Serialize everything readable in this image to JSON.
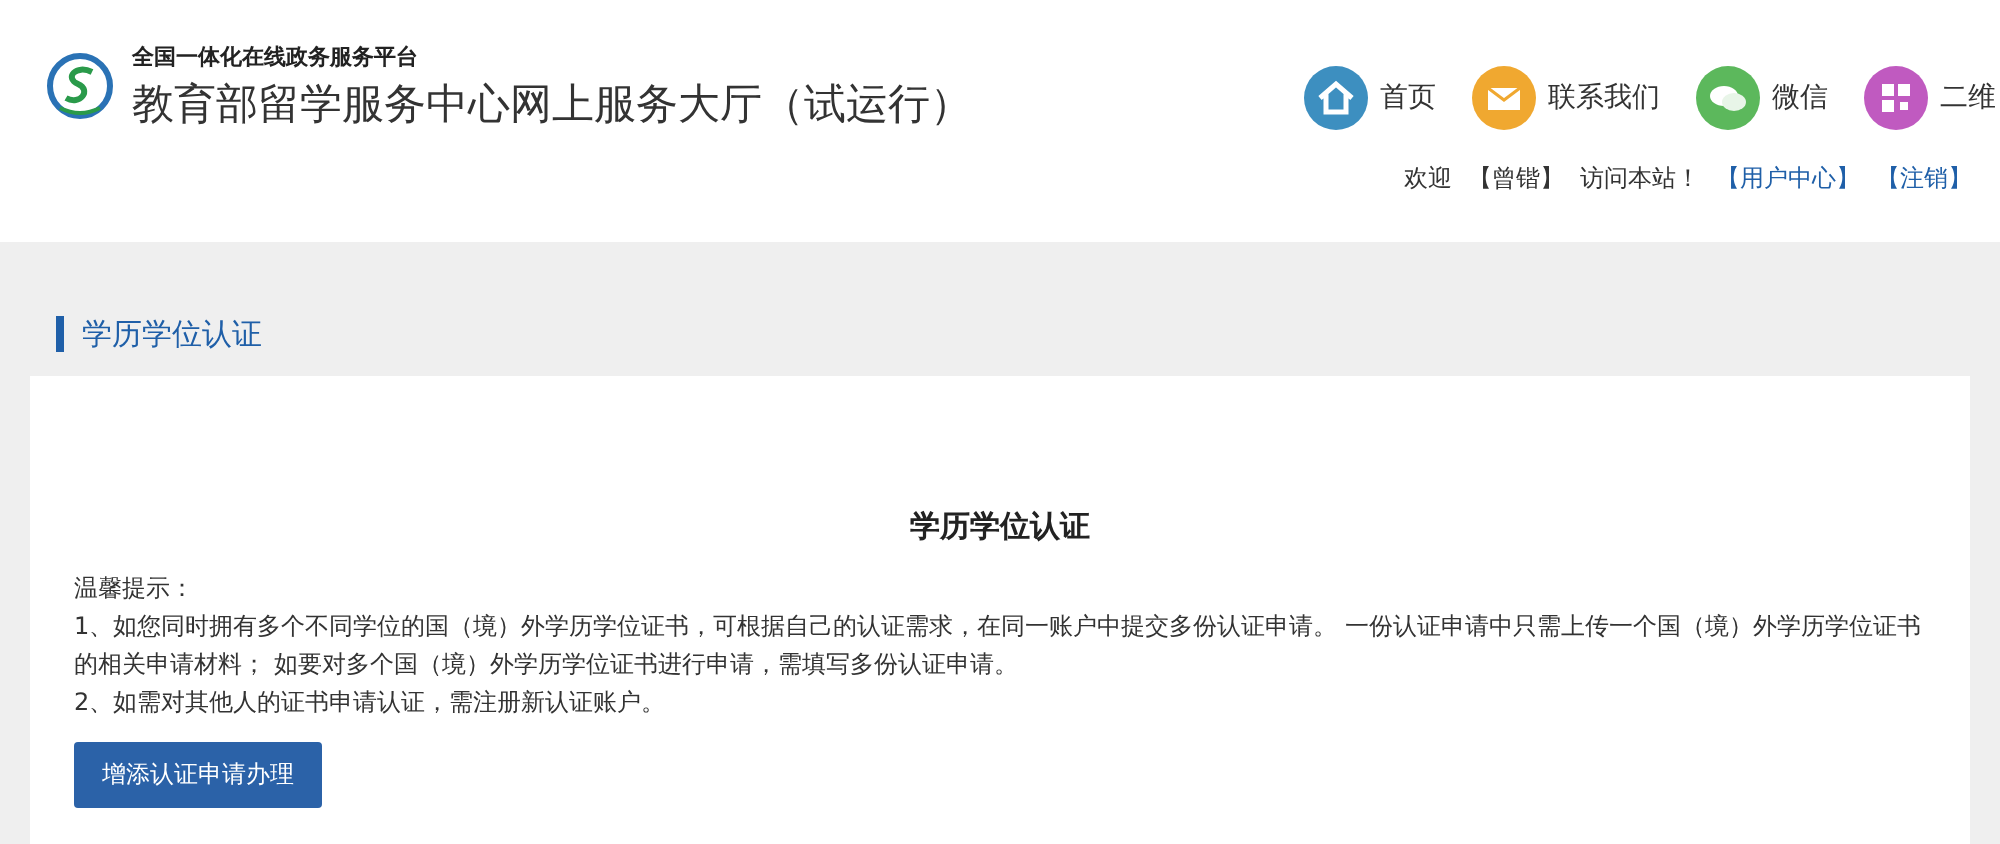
{
  "header": {
    "subtitle": "全国一体化在线政务服务平台",
    "title": "教育部留学服务中心网上服务大厅（试运行）"
  },
  "nav": [
    {
      "kind": "home",
      "label": "首页"
    },
    {
      "kind": "mail",
      "label": "联系我们"
    },
    {
      "kind": "chat",
      "label": "微信"
    },
    {
      "kind": "qr",
      "label": "二维"
    }
  ],
  "user_bar": {
    "greeting": "欢迎",
    "user": "【曾锴】",
    "suffix": "访问本站！",
    "links": [
      "【用户中心】",
      "【注销】"
    ]
  },
  "section_title": "学历学位认证",
  "card": {
    "title": "学历学位认证",
    "tip_label": "温馨提示：",
    "tips": [
      "1、如您同时拥有多个不同学位的国（境）外学历学位证书，可根据自己的认证需求，在同一账户中提交多份认证申请。 一份认证申请中只需上传一个国（境）外学历学位证书的相关申请材料； 如要对多个国（境）外学历学位证书进行申请，需填写多份认证申请。",
      "2、如需对其他人的证书申请认证，需注册新认证账户。"
    ],
    "button": "增添认证申请办理"
  }
}
